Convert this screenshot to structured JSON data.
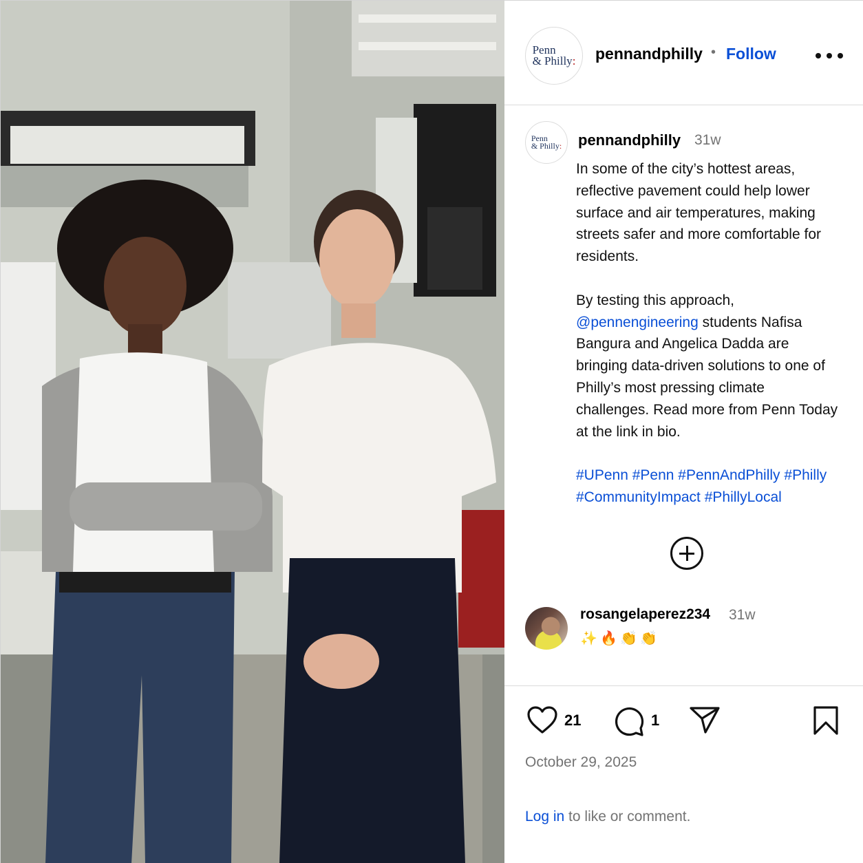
{
  "post": {
    "username": "pennandphilly",
    "separator": "•",
    "follow_label": "Follow",
    "avatar_logo": {
      "line1": "Penn",
      "line2": "& Philly",
      "mark": ":"
    },
    "photo_icon": "photo-two-students-in-lab"
  },
  "caption": {
    "username": "pennandphilly",
    "time": "31w",
    "lines_p1": [
      "In some of the city’s hottest areas,",
      "reflective pavement could help lower",
      "surface and air temperatures, making",
      "streets safer and more comfortable for",
      "residents."
    ],
    "line_p2_1": "By testing this approach,",
    "mention": "@pennengineering",
    "line_p2_2_rest": " students Nafisa",
    "lines_p2_rest": [
      "Bangura and Angelica Dadda are",
      "bringing data-driven solutions to one of",
      "Philly’s most pressing climate",
      "challenges. Read more from Penn Today",
      "at the link in bio."
    ],
    "hashtags_line1": "#UPenn #Penn #PennAndPhilly #Philly",
    "hashtags_line2": "#CommunityImpact #PhillyLocal"
  },
  "comment": {
    "username": "rosangelaperez234",
    "time": "31w",
    "emojis": [
      "✨",
      "🔥",
      "👏",
      "👏"
    ]
  },
  "actions": {
    "likes": "21",
    "comments": "1",
    "icons": [
      "heart-icon",
      "comment-icon",
      "share-icon",
      "bookmark-icon"
    ]
  },
  "date": "October 29, 2025",
  "login": {
    "link": "Log in",
    "rest": " to like or comment."
  },
  "colors": {
    "link": "#0a4fd6",
    "muted": "#737373",
    "divider": "#dbdbdb"
  }
}
